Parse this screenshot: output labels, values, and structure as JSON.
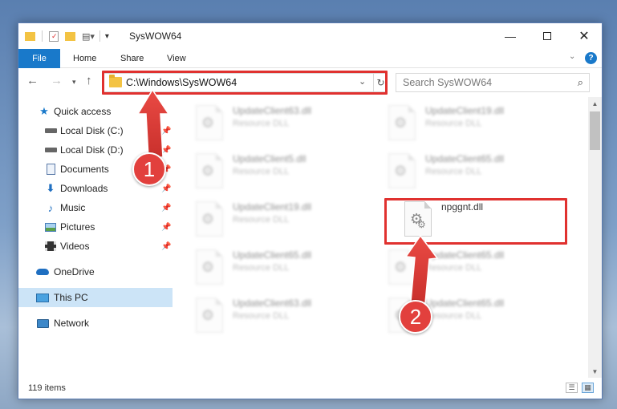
{
  "window": {
    "title": "SysWOW64"
  },
  "ribbon": {
    "tabs": [
      "File",
      "Home",
      "Share",
      "View"
    ],
    "help_label": "?"
  },
  "address": {
    "path": "C:\\Windows\\SysWOW64",
    "search_placeholder": "Search SysWOW64"
  },
  "sidebar": {
    "items": [
      {
        "label": "Quick access",
        "icon": "star-icon",
        "pinned": false
      },
      {
        "label": "Local Disk (C:)",
        "icon": "drive-icon",
        "pinned": true
      },
      {
        "label": "Local Disk (D:)",
        "icon": "drive-icon",
        "pinned": true
      },
      {
        "label": "Documents",
        "icon": "documents-icon",
        "pinned": true
      },
      {
        "label": "Downloads",
        "icon": "download-icon",
        "pinned": true
      },
      {
        "label": "Music",
        "icon": "music-icon",
        "pinned": true
      },
      {
        "label": "Pictures",
        "icon": "pictures-icon",
        "pinned": true
      },
      {
        "label": "Videos",
        "icon": "video-icon",
        "pinned": true
      },
      {
        "label": "OneDrive",
        "icon": "cloud-icon",
        "pinned": false
      },
      {
        "label": "This PC",
        "icon": "computer-icon",
        "pinned": false,
        "selected": true
      },
      {
        "label": "Network",
        "icon": "network-icon",
        "pinned": false
      }
    ]
  },
  "files": [
    {
      "name": "UpdateClient63.dll",
      "type": "Resource DLL",
      "blurred": true
    },
    {
      "name": "UpdateClient19.dll",
      "type": "Resource DLL",
      "blurred": true
    },
    {
      "name": "UpdateClient5.dll",
      "type": "Resource DLL",
      "blurred": true
    },
    {
      "name": "UpdateClient65.dll",
      "type": "Resource DLL",
      "blurred": true
    },
    {
      "name": "UpdateClient19.dll",
      "type": "Resource DLL",
      "blurred": true
    },
    {
      "name": "npggnt.dll",
      "type": "",
      "blurred": false
    },
    {
      "name": "UpdateClient65.dll",
      "type": "Resource DLL",
      "blurred": true
    },
    {
      "name": "UpdateClient65.dll",
      "type": "Resource DLL",
      "blurred": true
    },
    {
      "name": "UpdateClient63.dll",
      "type": "Resource DLL",
      "blurred": true
    },
    {
      "name": "UpdateClient65.dll",
      "type": "Resource DLL",
      "blurred": true
    }
  ],
  "status": {
    "item_count": "119 items"
  },
  "callouts": {
    "one": "1",
    "two": "2"
  },
  "colors": {
    "accent": "#1979ca",
    "highlight": "#e0312f",
    "selected": "#cce4f7"
  }
}
